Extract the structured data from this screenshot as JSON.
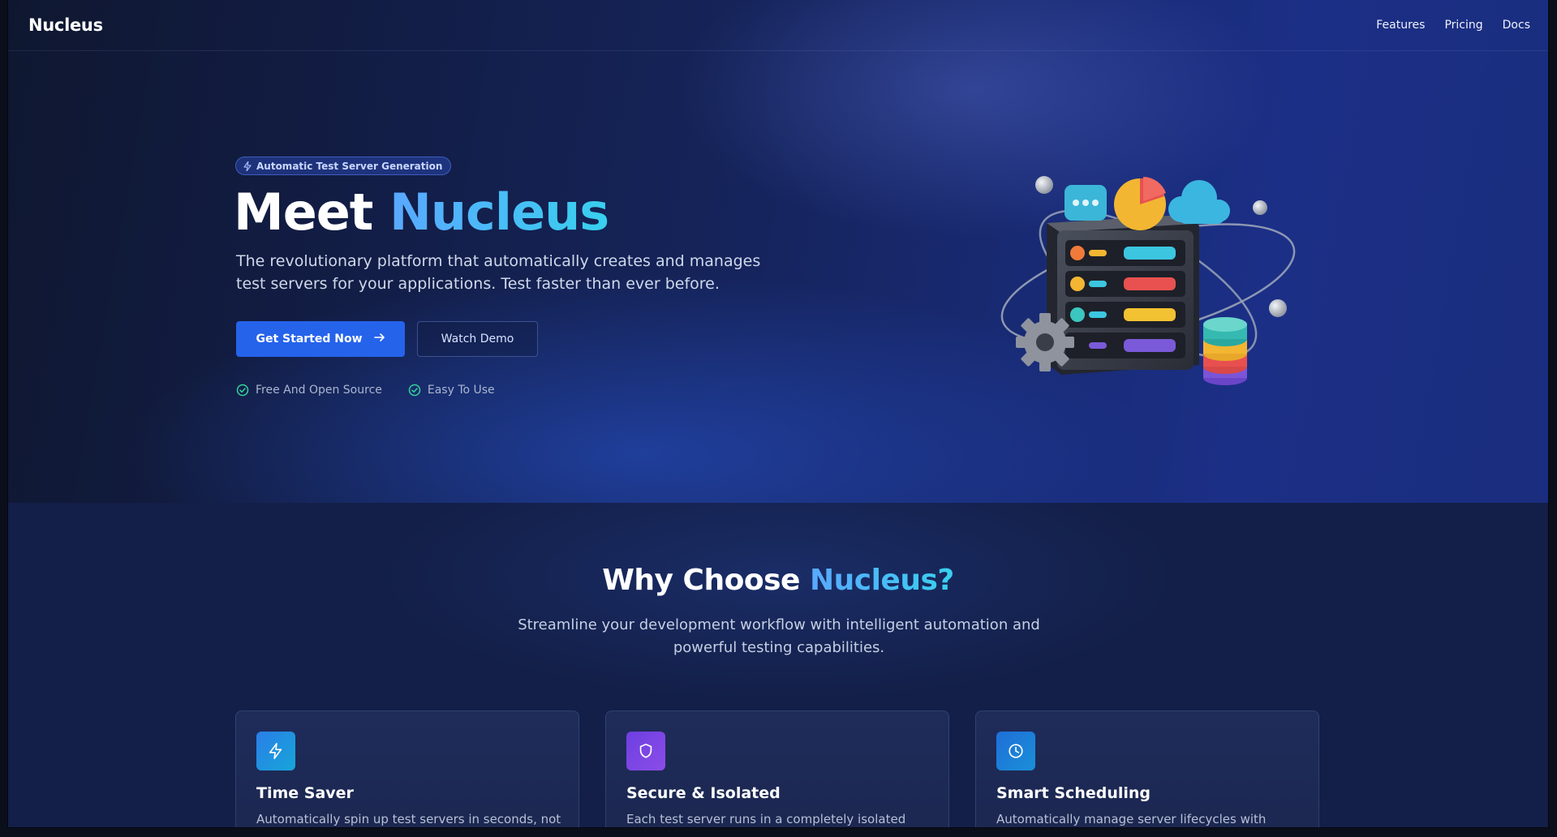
{
  "header": {
    "brand": "Nucleus",
    "nav": [
      "Features",
      "Pricing",
      "Docs"
    ]
  },
  "hero": {
    "badge": "Automatic Test Server Generation",
    "title_prefix": "Meet",
    "title_accent": "Nucleus",
    "subtitle": "The revolutionary platform that automatically creates and manages test servers for your applications. Test faster than ever before.",
    "primary_cta": "Get Started Now",
    "secondary_cta": "Watch Demo",
    "checks": [
      "Free And Open Source",
      "Easy To Use"
    ]
  },
  "why": {
    "title_prefix": "Why Choose",
    "title_accent": "Nucleus?",
    "subtitle": "Streamline your development workflow with intelligent automation and powerful testing capabilities.",
    "cards": [
      {
        "icon": "lightning-icon",
        "title": "Time Saver",
        "desc": "Automatically spin up test servers in seconds, not",
        "color": "#1d8fe0"
      },
      {
        "icon": "shield-icon",
        "title": "Secure & Isolated",
        "desc": "Each test server runs in a completely isolated",
        "color": "#7c3aed"
      },
      {
        "icon": "clock-icon",
        "title": "Smart Scheduling",
        "desc": "Automatically manage server lifecycles with",
        "color": "#1e7fd0"
      }
    ]
  },
  "colors": {
    "primary": "#2563eb",
    "accent_gradient_start": "#5aa8ff",
    "accent_gradient_end": "#38d0ee",
    "check": "#34d399"
  }
}
